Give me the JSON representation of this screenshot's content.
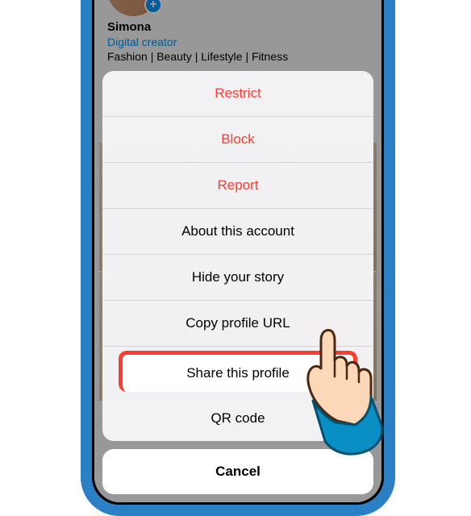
{
  "profile": {
    "name": "Simona",
    "category": "Digital creator",
    "bio": "Fashion | Beauty | Lifestyle | Fitness"
  },
  "actionSheet": {
    "items": [
      {
        "label": "Restrict",
        "destructive": true
      },
      {
        "label": "Block",
        "destructive": true
      },
      {
        "label": "Report",
        "destructive": true
      },
      {
        "label": "About this account",
        "destructive": false
      },
      {
        "label": "Hide your story",
        "destructive": false
      },
      {
        "label": "Copy profile URL",
        "destructive": false
      },
      {
        "label": "Share this profile",
        "destructive": false,
        "highlighted": true
      },
      {
        "label": "QR code",
        "destructive": false
      }
    ],
    "cancel": "Cancel"
  }
}
